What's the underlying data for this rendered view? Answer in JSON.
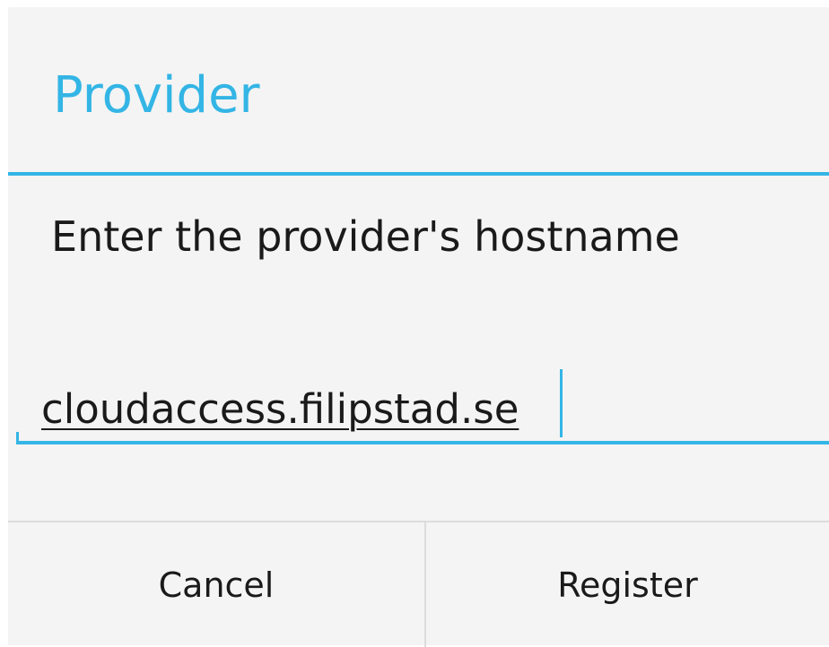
{
  "dialog": {
    "title": "Provider",
    "message": "Enter the provider's hostname",
    "input": {
      "value": "cloudaccess.filipstad.se"
    },
    "buttons": {
      "cancel_label": "Cancel",
      "register_label": "Register"
    }
  },
  "colors": {
    "accent": "#33b5e5",
    "background": "#f4f4f4",
    "text": "#1a1a1a",
    "divider": "#dcdcdc"
  }
}
